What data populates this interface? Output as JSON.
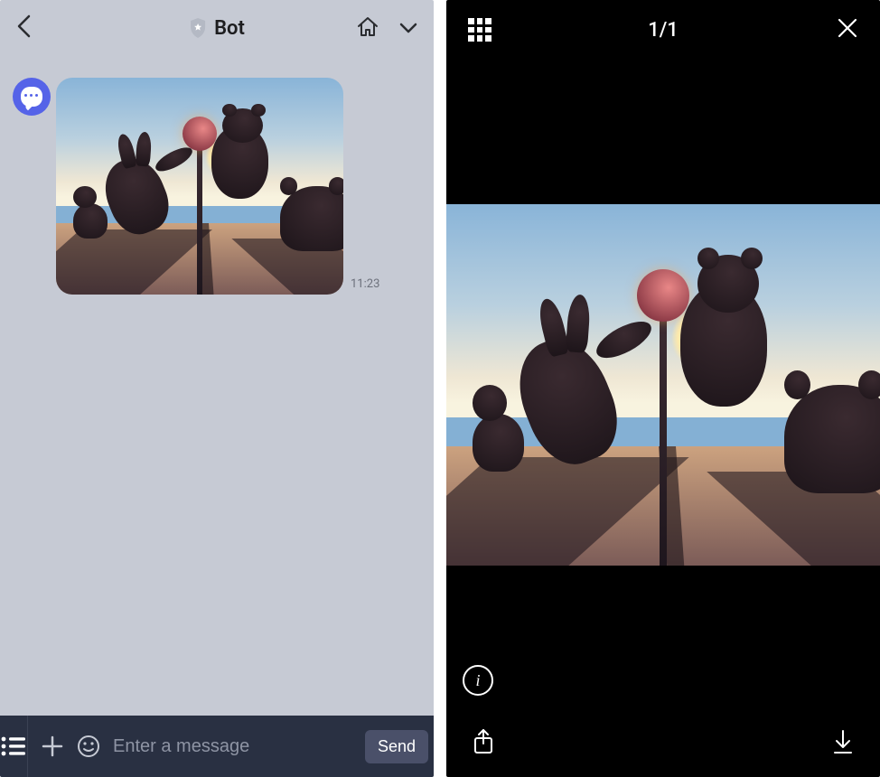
{
  "chat": {
    "header": {
      "title": "Bot"
    },
    "message": {
      "timestamp": "11:23"
    },
    "input": {
      "placeholder": "Enter a message",
      "send_label": "Send"
    }
  },
  "viewer": {
    "counter": "1/1",
    "info_glyph": "i"
  }
}
